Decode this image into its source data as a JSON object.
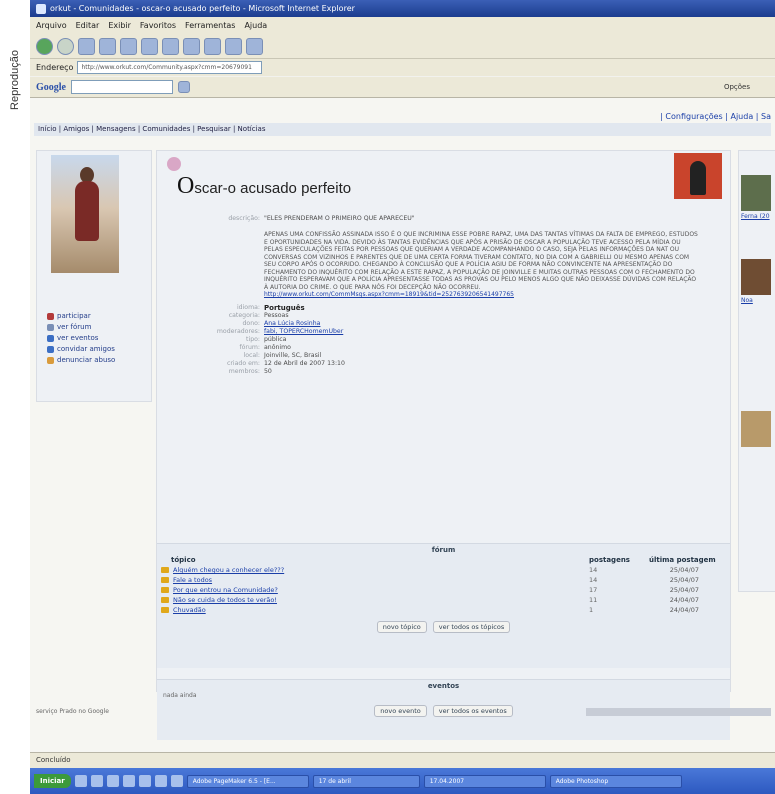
{
  "credit": "Reprodução",
  "window": {
    "title": "orkut - Comunidades - oscar-o acusado perfeito - Microsoft Internet Explorer",
    "menu": [
      "Arquivo",
      "Editar",
      "Exibir",
      "Favoritos",
      "Ferramentas",
      "Ajuda"
    ],
    "address_label": "Endereço",
    "address_value": "http://www.orkut.com/Community.aspx?cmm=20679091"
  },
  "toolbar": {
    "google_label": "Google",
    "options_label": "Opções"
  },
  "page": {
    "top_links": "| Configurações | Ajuda | Sa",
    "nav": "Início | Amigos | Mensagens | Comunidades | Pesquisar | Notícias",
    "community_title_initial": "O",
    "community_title_rest": "scar-o acusado perfeito",
    "fields": {
      "descricao_label": "descrição:",
      "descricao_heading": "\"ELES PRENDERAM O PRIMEIRO QUE APARECEU\"",
      "descricao_body": "APENAS UMA CONFISSÃO ASSINADA ISSO É O QUE INCRIMINA ESSE POBRE RAPAZ, UMA DAS TANTAS VÍTIMAS DA FALTA DE EMPREGO, ESTUDOS E OPORTUNIDADES NA VIDA. DEVIDO ÀS TANTAS EVIDÊNCIAS QUE APÓS A PRISÃO DE OSCAR A POPULAÇÃO TEVE ACESSO PELA MÍDIA OU PELAS ESPECULAÇÕES FEITAS POR PESSOAS QUE QUERIAM A VERDADE ACOMPANHANDO O CASO, SEJA PELAS INFORMAÇÕES DA NAT OU CONVERSAS COM VIZINHOS E PARENTES QUE DE UMA CERTA FORMA TIVERAM CONTATO, NO DIA COM A GABRIELLI OU MESMO APENAS COM SEU CORPO APÓS O OCORRIDO. CHEGANDO À CONCLUSÃO QUE A POLÍCIA AGIU DE FORMA NÃO CONVINCENTE NA APRESENTAÇÃO DO FECHAMENTO DO INQUÉRITO COM RELAÇÃO A ESTE RAPAZ, A POPULAÇÃO DE JOINVILLE E MUITAS OUTRAS PESSOAS COM O FECHAMENTO DO INQUÉRITO ESPERAVAM QUE A POLÍCIA APRESENTASSE TODAS AS PROVAS OU PELO MENOS ALGO QUE NÃO DEIXASSE DÚVIDAS COM RELAÇÃO À AUTORIA DO CRIME. O QUE PARA NÓS FOI DECEPÇÃO NÃO OCORREU.",
      "descricao_link": "http://www.orkut.com/CommMsgs.aspx?cmm=18919&tid=2527639206541497765",
      "idioma_label": "idioma:",
      "idioma_value": "Português",
      "categoria_label": "categoria:",
      "categoria_value": "Pessoas",
      "dono_label": "dono:",
      "dono_value": "Ana Lúcia Rosinha",
      "moderadores_label": "moderadores:",
      "moderadores_value": "fabi, TOPERCHomemUber",
      "tipo_label": "tipo:",
      "tipo_value": "pública",
      "forum_label": "fórum:",
      "forum_value": "anônimo",
      "local_label": "local:",
      "local_value": "Joinville, SC, Brasil",
      "criado_label": "criado em:",
      "criado_value": "12 de Abril de 2007 13:10",
      "membros_label": "membros:",
      "membros_value": "50"
    },
    "left_menu": [
      {
        "label": "participar",
        "icon": "people-icon",
        "color": "#b33a3a"
      },
      {
        "label": "ver fórum",
        "icon": "forum-icon",
        "color": "#7a8fb6"
      },
      {
        "label": "ver eventos",
        "icon": "event-icon",
        "color": "#3c6fc4"
      },
      {
        "label": "convidar amigos",
        "icon": "invite-icon",
        "color": "#3c6fc4"
      },
      {
        "label": "denunciar abuso",
        "icon": "report-icon",
        "color": "#d99b3c"
      }
    ],
    "forum": {
      "title": "fórum",
      "col_topic": "tópico",
      "col_posts": "postagens",
      "col_last": "última postagem",
      "rows": [
        {
          "topic": "Alguém chegou a conhecer ele???",
          "posts": "14",
          "last": "25/04/07"
        },
        {
          "topic": "Fale a todos",
          "posts": "14",
          "last": "25/04/07"
        },
        {
          "topic": "Por que entrou na Comunidade?",
          "posts": "17",
          "last": "25/04/07"
        },
        {
          "topic": "Não se cuida de todos te verão!",
          "posts": "11",
          "last": "24/04/07"
        },
        {
          "topic": "Chuvadão",
          "posts": "1",
          "last": "24/04/07"
        }
      ],
      "btn_new": "novo tópico",
      "btn_all": "ver todos os tópicos"
    },
    "events": {
      "title": "eventos",
      "empty": "nada ainda",
      "btn_new": "novo evento",
      "btn_all": "ver todos os eventos"
    },
    "right_links": [
      "Ferna (20",
      "Noa"
    ],
    "footer": "serviço Prado no Google"
  },
  "status": {
    "text": "Concluído"
  },
  "taskbar": {
    "start": "Iniciar",
    "buttons": [
      "Adobe PageMaker 6.5 - [E...",
      "17 de abril",
      "17.04.2007",
      "Adobe Photoshop"
    ]
  }
}
